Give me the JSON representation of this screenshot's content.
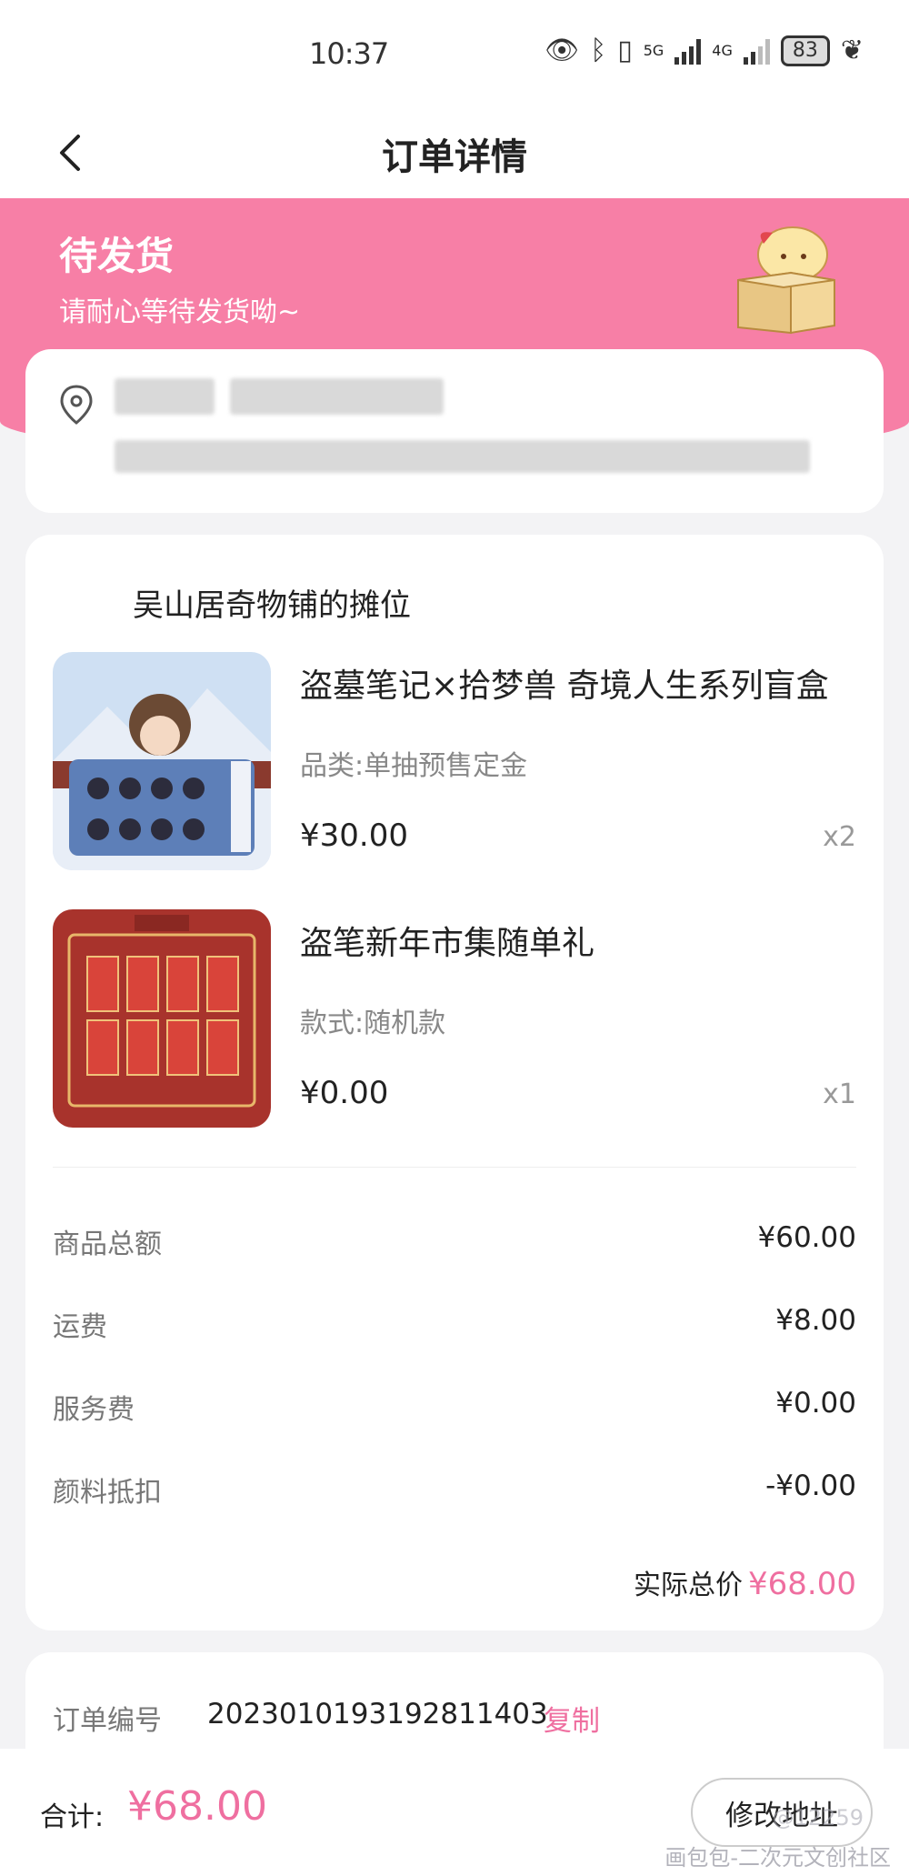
{
  "status_bar": {
    "time": "10:37",
    "network_5g": "5G",
    "network_4g": "4G",
    "battery": "83"
  },
  "nav": {
    "title": "订单详情"
  },
  "banner": {
    "status": "待发货",
    "subtitle": "请耐心等待发货呦~"
  },
  "order": {
    "shop_name": "吴山居奇物铺的摊位",
    "items": [
      {
        "name": "盗墓笔记×拾梦兽 奇境人生系列盲盒",
        "spec": "品类:单抽预售定金",
        "price": "¥30.00",
        "qty": "x2"
      },
      {
        "name": "盗笔新年市集随单礼",
        "spec": "款式:随机款",
        "price": "¥0.00",
        "qty": "x1"
      }
    ],
    "summary": [
      {
        "label": "商品总额",
        "value": "¥60.00"
      },
      {
        "label": "运费",
        "value": "¥8.00"
      },
      {
        "label": "服务费",
        "value": "¥0.00"
      },
      {
        "label": "颜料抵扣",
        "value": "-¥0.00"
      }
    ],
    "total_label": "实际总价",
    "total_value": "¥68.00"
  },
  "info": {
    "order_no_label": "订单编号",
    "order_no": "2023010193192811403",
    "copy_label": "复制"
  },
  "bottom": {
    "sum_label": "合计:",
    "sum_value": "¥68.00",
    "modify_address": "修改地址"
  },
  "watermark": {
    "text": "画包包-二次元文创社区",
    "user": "@12259"
  },
  "colors": {
    "accent": "#ef6fa0",
    "banner": "#f77fa6"
  }
}
